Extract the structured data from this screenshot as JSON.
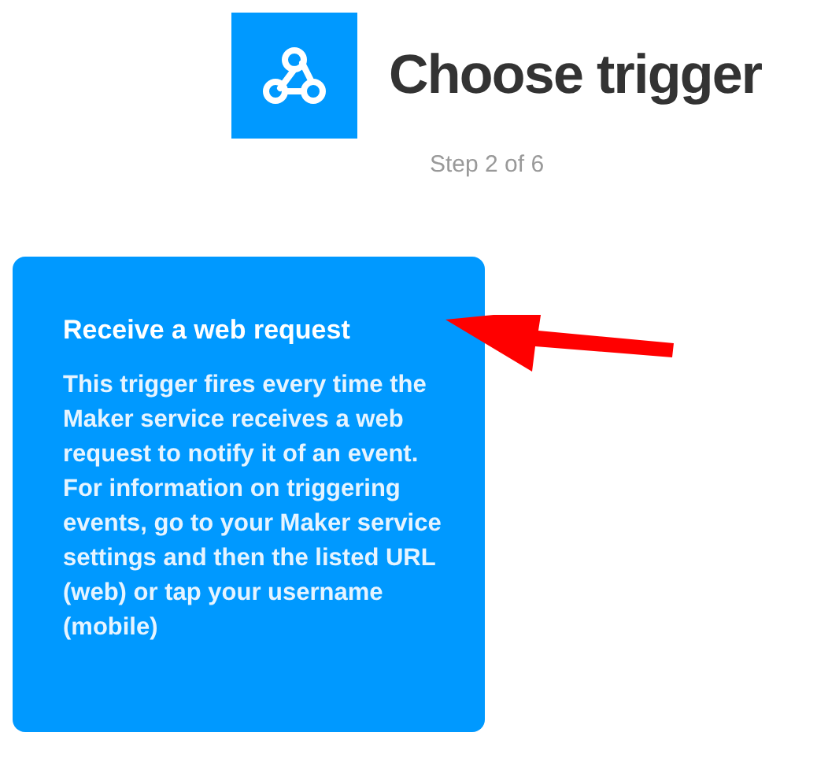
{
  "header": {
    "title": "Choose trigger",
    "step": "Step 2 of 6"
  },
  "triggers": [
    {
      "title": "Receive a web request",
      "description": "This trigger fires every time the Maker service receives a web request to notify it of an event. For information on triggering events, go to your Maker service settings and then the listed URL (web) or tap your username (mobile)"
    }
  ]
}
